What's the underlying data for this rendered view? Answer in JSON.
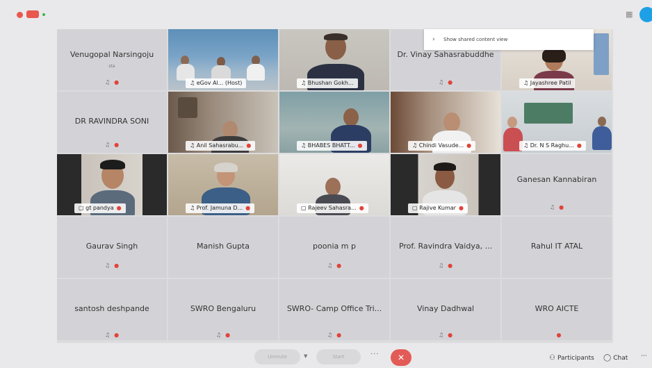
{
  "toolbar_top": {
    "grid_icon": "grid-icon"
  },
  "banner": {
    "text": "Show shared content view",
    "chevron": "›"
  },
  "tiles": {
    "t1": {
      "name": "Venugopal Narsingoju",
      "sub": "sta"
    },
    "t2": {
      "label": "eGov Al... (Host)"
    },
    "t3": {
      "label": "Bhushan Gokh..."
    },
    "t4": {
      "name": "Dr. Vinay Sahasrabuddhe"
    },
    "t5": {
      "label": "Jayashree Patil"
    },
    "t6": {
      "name": "DR RAVINDRA SONI"
    },
    "t7": {
      "label": "Anil Sahasrabu..."
    },
    "t8": {
      "label": "BHABES BHATT..."
    },
    "t9": {
      "label": "Chindi Vasude..."
    },
    "t10": {
      "label": "Dr. N S Raghu..."
    },
    "t11": {
      "label": "gt pandya"
    },
    "t12": {
      "label": "Prof. Jamuna D..."
    },
    "t13": {
      "label": "Rajeev Sahasra..."
    },
    "t14": {
      "label": "Rajive Kumar"
    },
    "t15": {
      "name": "Ganesan Kannabiran"
    },
    "t16": {
      "name": "Gaurav Singh"
    },
    "t17": {
      "name": "Manish Gupta"
    },
    "t18": {
      "name": "poonia m p"
    },
    "t19": {
      "name": "Prof. Ravindra Vaidya, ..."
    },
    "t20": {
      "name": "Rahul IT ATAL"
    },
    "t21": {
      "name": "santosh deshpande"
    },
    "t22": {
      "name": "SWRO Bengaluru"
    },
    "t23": {
      "name": "SWRO- Camp Office Tri..."
    },
    "t24": {
      "name": "Vinay Dadhwal"
    },
    "t25": {
      "name": "WRO AICTE"
    }
  },
  "bottom": {
    "mute_label": "Unmute",
    "video_label": "Start",
    "more": "···",
    "end_icon": "✕",
    "participants": "Participants",
    "chat": "Chat",
    "overflow": "···"
  },
  "colors": {
    "accent": "#27a9e6",
    "end": "#e35b57",
    "mic_muted": "#e0443a"
  }
}
